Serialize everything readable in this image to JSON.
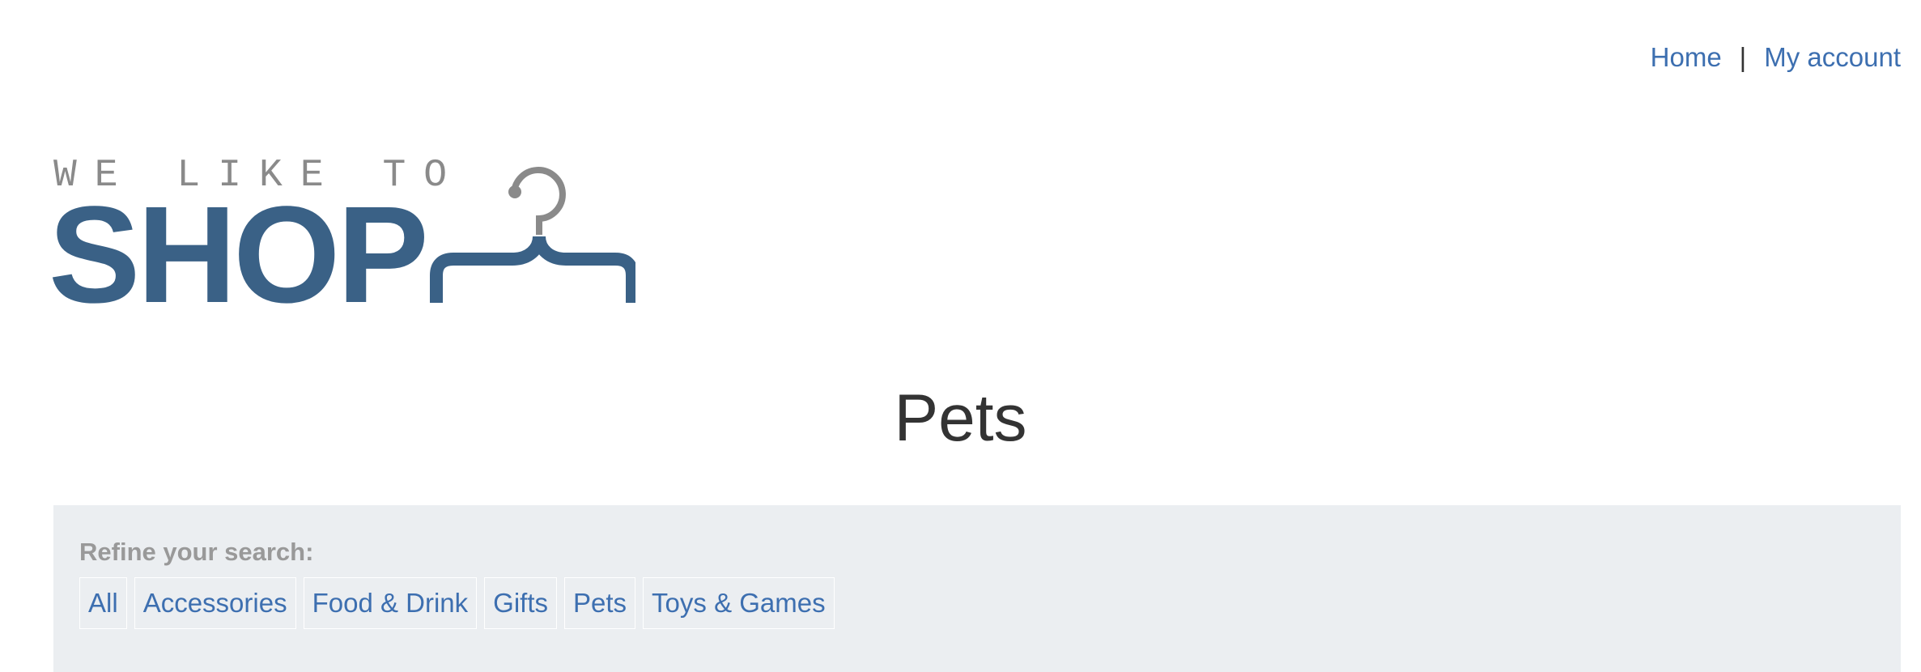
{
  "nav": {
    "home_label": "Home",
    "separator": "|",
    "account_label": "My account"
  },
  "logo": {
    "tagline": "WE LIKE TO",
    "wordmark": "SHOP",
    "icon": "hanger-icon",
    "colors": {
      "tagline": "#8a8a8a",
      "wordmark": "#3a6186"
    }
  },
  "page": {
    "title": "Pets"
  },
  "refine": {
    "label": "Refine your search:",
    "filters": [
      "All",
      "Accessories",
      "Food & Drink",
      "Gifts",
      "Pets",
      "Toys & Games"
    ]
  },
  "colors": {
    "link": "#3d6fb0",
    "panel_bg": "#ebeef1",
    "text": "#333333"
  }
}
